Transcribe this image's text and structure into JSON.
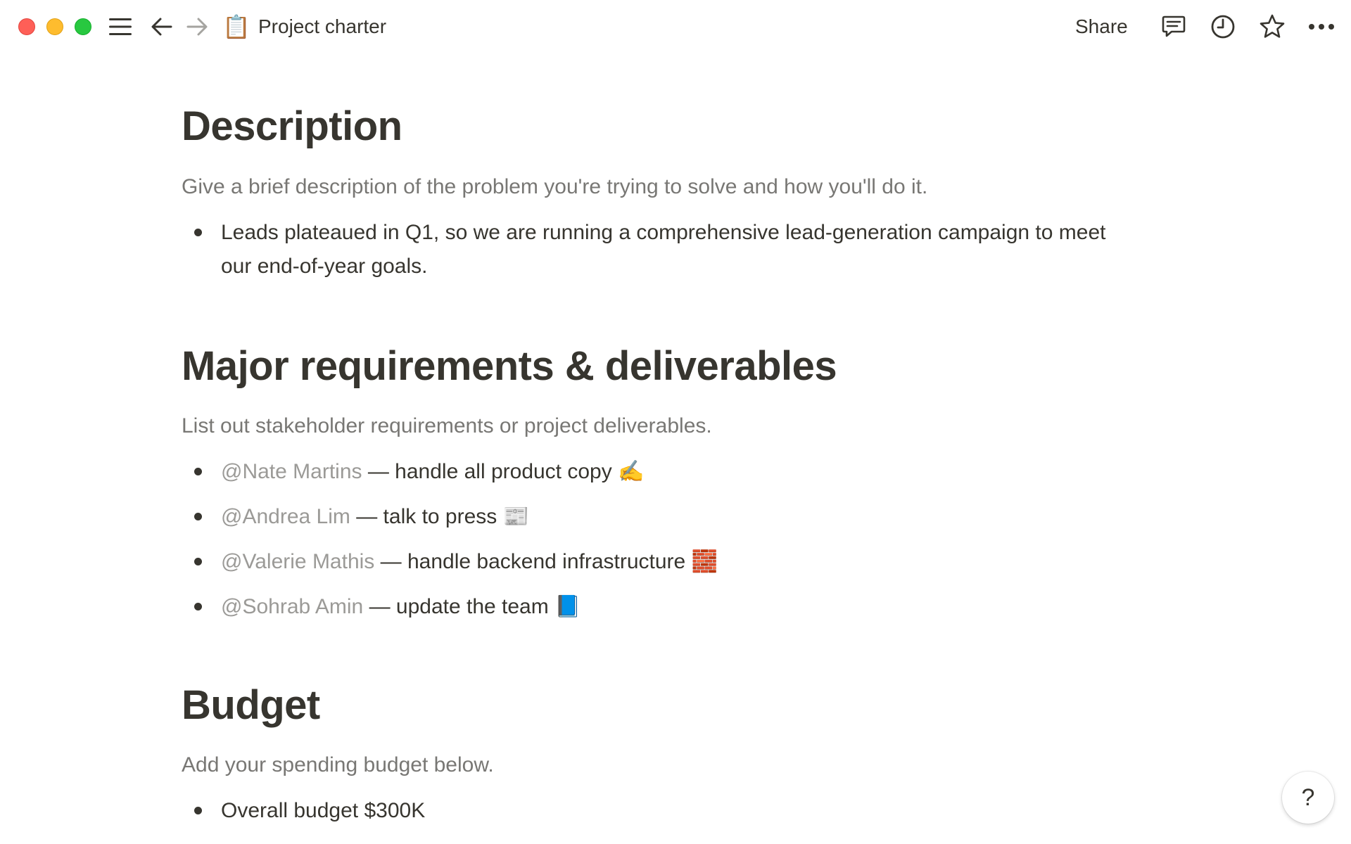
{
  "topbar": {
    "page_emoji": "📋",
    "page_title": "Project charter",
    "share_label": "Share"
  },
  "sections": {
    "description": {
      "heading": "Description",
      "placeholder": "Give a brief description of the problem you're trying to solve and how you'll do it.",
      "bullets": [
        "Leads plateaued in Q1, so we are running a comprehensive lead-generation campaign to meet our end-of-year goals."
      ]
    },
    "requirements": {
      "heading": "Major requirements & deliverables",
      "placeholder": "List out stakeholder requirements or project deliverables.",
      "items": [
        {
          "mention": "@Nate Martins",
          "text": " — handle all product copy ✍️"
        },
        {
          "mention": "@Andrea Lim",
          "text": " — talk to press 📰"
        },
        {
          "mention": "@Valerie Mathis",
          "text": " — handle backend infrastructure 🧱"
        },
        {
          "mention": "@Sohrab Amin",
          "text": " — update the team 📘"
        }
      ]
    },
    "budget": {
      "heading": "Budget",
      "placeholder": "Add your spending budget below.",
      "bullets": [
        "Overall budget $300K"
      ]
    }
  },
  "help_label": "?",
  "icons": {
    "menu": "hamburger-menu-icon",
    "back": "arrow-left-icon",
    "forward": "arrow-right-icon",
    "comments": "comment-icon",
    "updates": "clock-icon",
    "favorite": "star-icon",
    "more": "more-dots-icon"
  },
  "colors": {
    "text": "#37352f",
    "muted": "#787774",
    "mention": "#9b9a97"
  }
}
